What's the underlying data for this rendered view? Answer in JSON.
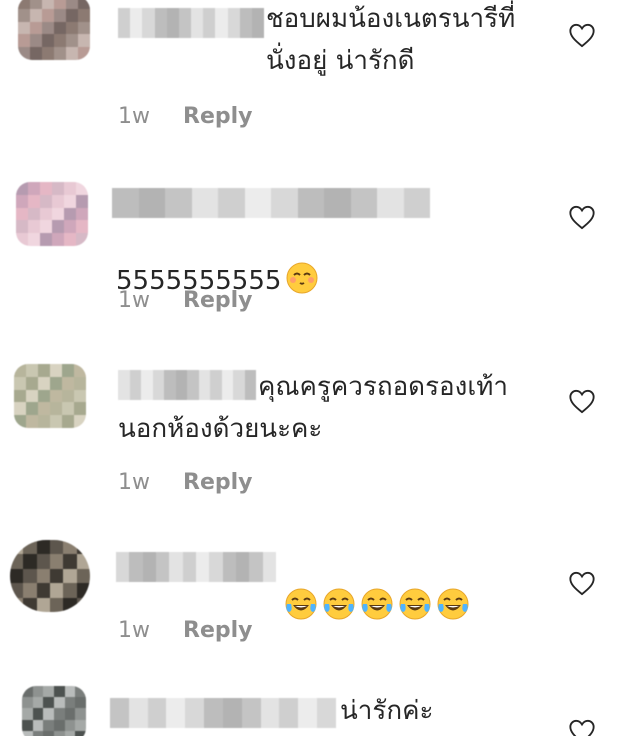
{
  "comments": [
    {
      "text": "ชอบผมน้องเนตรนารีที่\nนั่งอยู่ น่ารักดี",
      "time": "1w",
      "reply": "Reply",
      "avatar_colors": [
        "#8c7a72",
        "#a1918a",
        "#c7b6b0",
        "#b89b95",
        "#9b8a86",
        "#766763"
      ]
    },
    {
      "text": "5555555555",
      "emoji": [
        "kissing-face-with-closed-eyes-emoji"
      ],
      "time": "1w",
      "reply": "Reply",
      "avatar_colors": [
        "#d6b9c6",
        "#e8c9d4",
        "#f0d6df",
        "#b69bb0",
        "#cfa7bb",
        "#e5b7c5"
      ]
    },
    {
      "text": "คุณครูควรถอดรองเท้า\nนอกห้องด้วยนะคะ",
      "time": "1w",
      "reply": "Reply",
      "avatar_colors": [
        "#b7b59c",
        "#c9c7b1",
        "#a7a98f",
        "#d8d3c1",
        "#9ea68d",
        "#bfb8a0"
      ]
    },
    {
      "text": "",
      "emoji": [
        "face-with-tears-of-joy-emoji",
        "face-with-tears-of-joy-emoji",
        "face-with-tears-of-joy-emoji",
        "face-with-tears-of-joy-emoji",
        "face-with-tears-of-joy-emoji"
      ],
      "time": "1w",
      "reply": "Reply",
      "avatar_colors": [
        "#5d564d",
        "#8a7f70",
        "#3f3a33",
        "#b0a695",
        "#6c6458",
        "#2d2a25"
      ]
    },
    {
      "text": "น่ารักค่ะ",
      "time": "",
      "reply": "",
      "avatar_colors": [
        "#6a6e6c",
        "#8e9290",
        "#a5a9a7",
        "#4d5250",
        "#b9bcbb",
        "#7a7e7c"
      ]
    }
  ],
  "colors": {
    "text": "#262626",
    "meta": "#8e8e8e",
    "emoji_yellow": "#ffcc3e"
  },
  "icons": {
    "like": "heart-outline-icon"
  }
}
